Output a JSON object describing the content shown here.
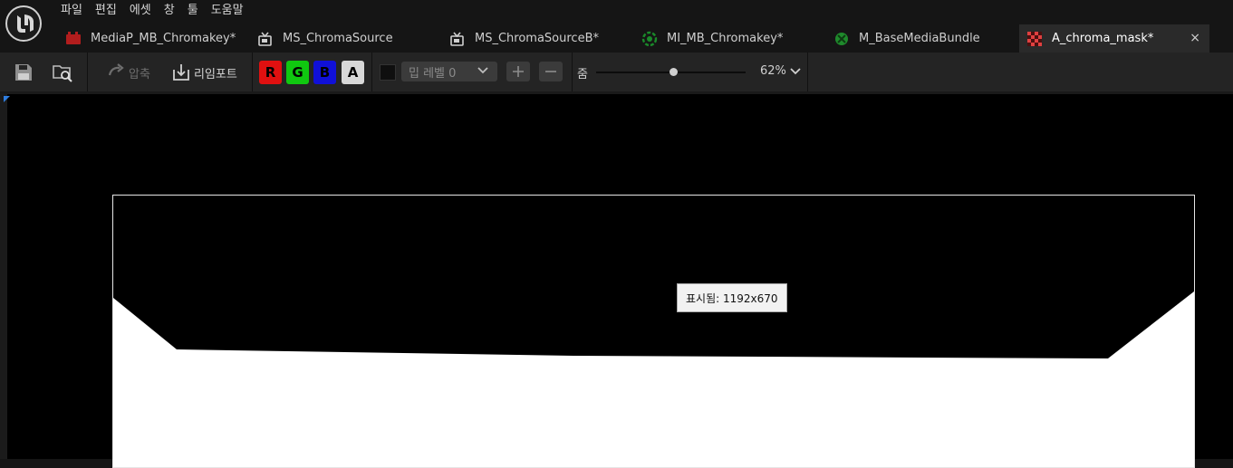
{
  "menu": [
    "파일",
    "편집",
    "에셋",
    "창",
    "툴",
    "도움말"
  ],
  "tabs": [
    {
      "label": "MediaP_MB_Chromakey*",
      "icon": "media-player-icon",
      "active": false
    },
    {
      "label": "MS_ChromaSource",
      "icon": "media-source-icon",
      "active": false
    },
    {
      "label": "MS_ChromaSourceB*",
      "icon": "media-source-icon",
      "active": false
    },
    {
      "label": "MI_MB_Chromakey*",
      "icon": "material-instance-icon",
      "active": false
    },
    {
      "label": "M_BaseMediaBundle",
      "icon": "material-icon",
      "active": false
    },
    {
      "label": "A_chroma_mask*",
      "icon": "texture-icon",
      "active": true
    }
  ],
  "tab_close": "×",
  "toolbar": {
    "compress_label": "압축",
    "reimport_label": "리임포트",
    "channels": {
      "r": "R",
      "g": "G",
      "b": "B",
      "a": "A"
    },
    "mip_level_label": "밉 레벨 0",
    "zoom_label": "줌",
    "zoom_value": "62%",
    "zoom_fraction": 0.52
  },
  "viewport": {
    "tooltip": "표시됨: 1192x670"
  },
  "colors": {
    "red": "#e01010",
    "green": "#10c810",
    "blue": "#1010d8",
    "alpha": "#d8d8d8",
    "accent": "#2e7de0"
  }
}
